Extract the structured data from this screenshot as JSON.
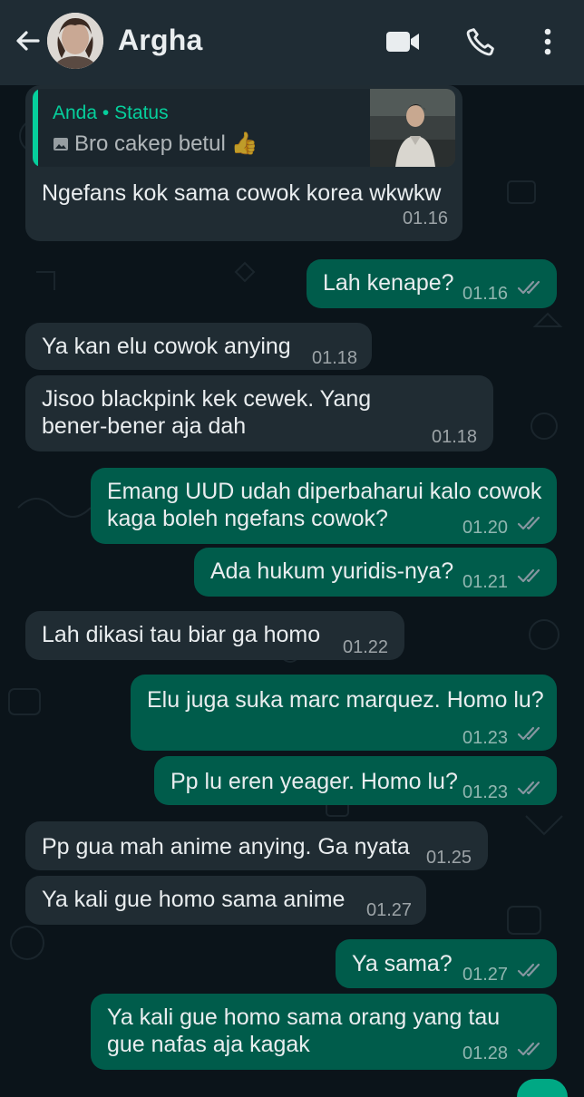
{
  "header": {
    "contact_name": "Argha",
    "back_icon": "arrow-left-icon",
    "video_icon": "video-camera-icon",
    "call_icon": "phone-icon",
    "menu_icon": "more-vertical-icon",
    "background_color": "#1f2c34"
  },
  "colors": {
    "incoming_bubble": "#202c33",
    "outgoing_bubble": "#005c4b",
    "chat_background": "#0b141a",
    "quote_accent": "#06cf9c",
    "read_ticks": "#8696a0"
  },
  "quoted_status": {
    "author": "Anda • Status",
    "text": "Bro cakep betul",
    "emoji": "👍",
    "icon": "image-icon"
  },
  "messages": [
    {
      "direction": "in",
      "text": "Ngefans kok sama cowok korea wkwkw",
      "time": "01.16"
    },
    {
      "direction": "out",
      "text": "Lah kenape?",
      "time": "01.16"
    },
    {
      "direction": "in",
      "text": "Ya kan elu cowok anying",
      "time": "01.18"
    },
    {
      "direction": "in",
      "text_line1": "Jisoo blackpink kek cewek. Yang",
      "text_line2": "bener-bener aja dah",
      "time": "01.18"
    },
    {
      "direction": "out",
      "text_line1": "Emang UUD udah diperbaharui kalo cowok",
      "text_line2": "kaga boleh ngefans cowok?",
      "time": "01.20"
    },
    {
      "direction": "out",
      "text": "Ada hukum yuridis-nya?",
      "time": "01.21"
    },
    {
      "direction": "in",
      "text": "Lah dikasi tau biar ga homo",
      "time": "01.22"
    },
    {
      "direction": "out",
      "text": "Elu juga suka marc marquez. Homo lu?",
      "time": "01.23"
    },
    {
      "direction": "out",
      "text": "Pp lu eren yeager. Homo lu?",
      "time": "01.23"
    },
    {
      "direction": "in",
      "text": "Pp gua mah anime anying. Ga nyata",
      "time": "01.25"
    },
    {
      "direction": "in",
      "text": "Ya kali gue homo sama anime",
      "time": "01.27"
    },
    {
      "direction": "out",
      "text": "Ya sama?",
      "time": "01.27"
    },
    {
      "direction": "out",
      "text_line1": "Ya kali gue homo sama orang yang tau",
      "text_line2": "gue nafas aja kagak",
      "time": "01.28"
    }
  ]
}
